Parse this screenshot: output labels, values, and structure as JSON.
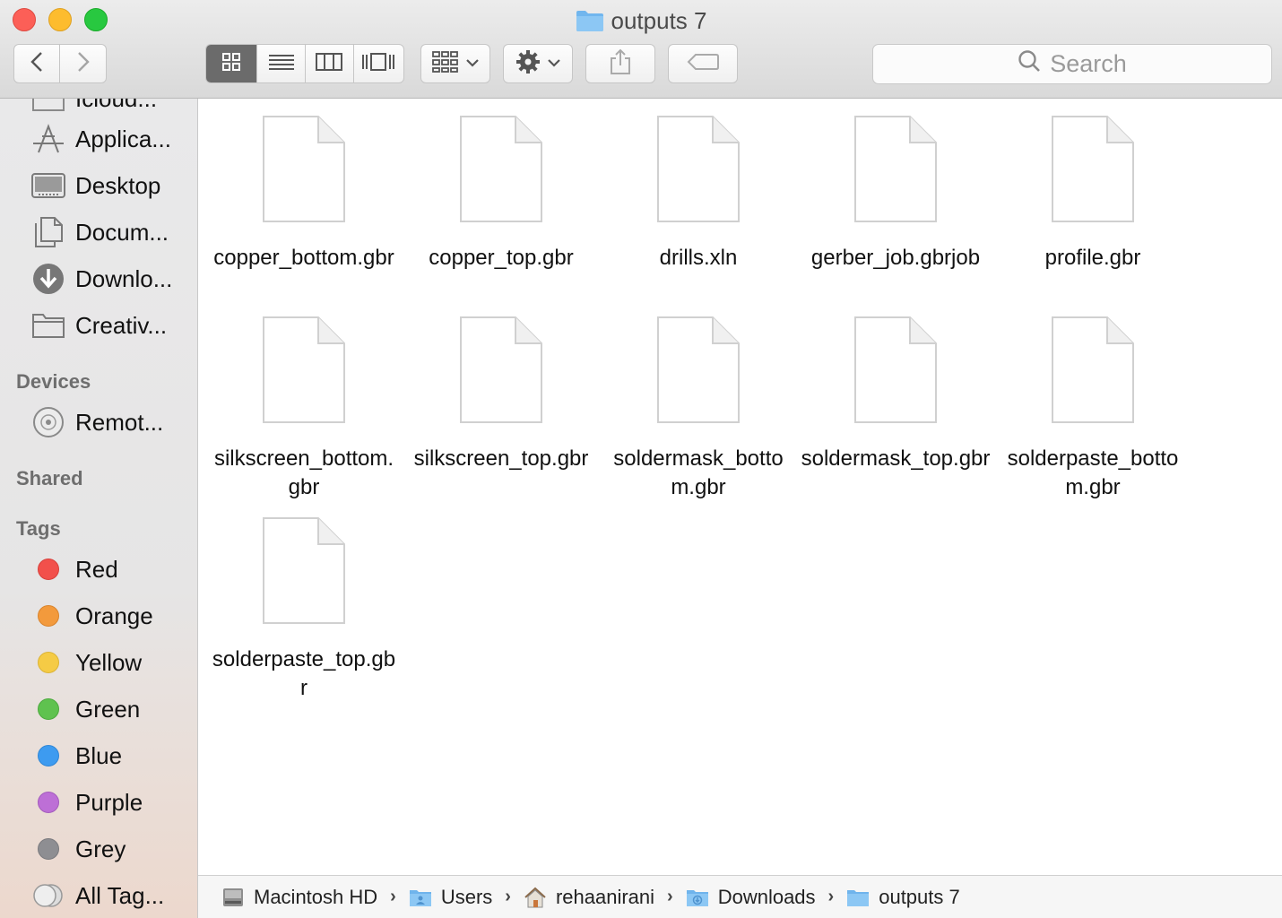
{
  "window": {
    "title": "outputs 7"
  },
  "toolbar": {
    "back_icon": "chevron-left-icon",
    "forward_icon": "chevron-right-icon",
    "view_modes": [
      "icon-view-icon",
      "list-view-icon",
      "column-view-icon",
      "cover-flow-icon"
    ],
    "active_view": "icon-view-icon",
    "arrange_icon": "arrange-grid-icon",
    "action_icon": "gear-icon",
    "share_icon": "share-icon",
    "tag_icon": "tag-icon",
    "search_placeholder": "Search"
  },
  "sidebar": {
    "partial_item": "Icloud...",
    "favorites": [
      {
        "label": "Applica...",
        "icon": "applications-icon"
      },
      {
        "label": "Desktop",
        "icon": "desktop-icon"
      },
      {
        "label": "Docum...",
        "icon": "documents-icon"
      },
      {
        "label": "Downlo...",
        "icon": "downloads-icon"
      },
      {
        "label": "Creativ...",
        "icon": "folder-icon"
      }
    ],
    "devices_header": "Devices",
    "devices": [
      {
        "label": "Remot...",
        "icon": "remote-disc-icon"
      }
    ],
    "shared_header": "Shared",
    "tags_header": "Tags",
    "tags": [
      {
        "label": "Red",
        "color": "#f2504b"
      },
      {
        "label": "Orange",
        "color": "#f39a3c"
      },
      {
        "label": "Yellow",
        "color": "#f5cb45"
      },
      {
        "label": "Green",
        "color": "#5fc24f"
      },
      {
        "label": "Blue",
        "color": "#3d9bf0"
      },
      {
        "label": "Purple",
        "color": "#bd6fd6"
      },
      {
        "label": "Grey",
        "color": "#8e8e92"
      },
      {
        "label": "All Tag...",
        "color": "all"
      }
    ]
  },
  "files": [
    "copper_bottom.gbr",
    "copper_top.gbr",
    "drills.xln",
    "gerber_job.gbrjob",
    "profile.gbr",
    "silkscreen_bottom.gbr",
    "silkscreen_top.gbr",
    "soldermask_bottom.gbr",
    "soldermask_top.gbr",
    "solderpaste_bottom.gbr",
    "solderpaste_top.gbr"
  ],
  "pathbar": [
    {
      "label": "Macintosh HD",
      "icon": "hard-drive-icon"
    },
    {
      "label": "Users",
      "icon": "users-folder-icon"
    },
    {
      "label": "rehaanirani",
      "icon": "home-icon"
    },
    {
      "label": "Downloads",
      "icon": "downloads-folder-icon"
    },
    {
      "label": "outputs 7",
      "icon": "folder-icon"
    }
  ]
}
